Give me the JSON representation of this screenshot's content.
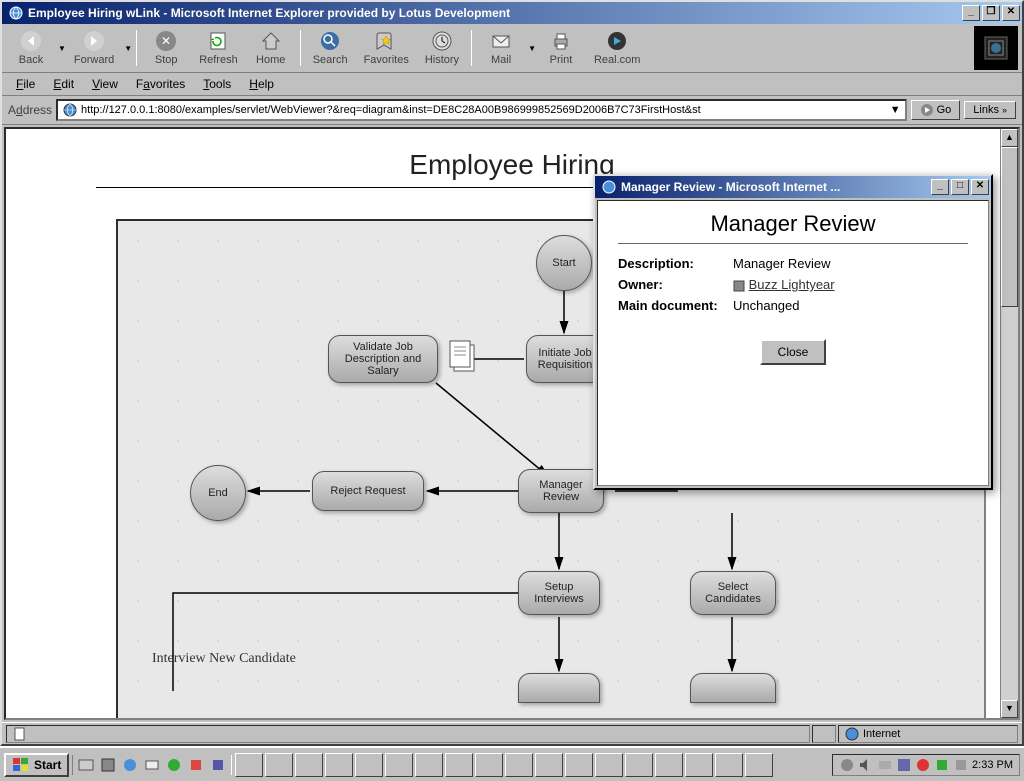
{
  "window": {
    "title": "Employee Hiring wLink - Microsoft Internet Explorer provided by Lotus Development"
  },
  "toolbar": {
    "back": "Back",
    "forward": "Forward",
    "stop": "Stop",
    "refresh": "Refresh",
    "home": "Home",
    "search": "Search",
    "favorites": "Favorites",
    "history": "History",
    "mail": "Mail",
    "print": "Print",
    "realcom": "Real.com"
  },
  "menu": {
    "file": "File",
    "edit": "Edit",
    "view": "View",
    "favorites": "Favorites",
    "tools": "Tools",
    "help": "Help"
  },
  "addressbar": {
    "label": "Address",
    "url": "http://127.0.0.1:8080/examples/servlet/WebViewer?&req=diagram&inst=DE8C28A00B986999852569D2006B7C73FirstHost&st",
    "go": "Go",
    "links": "Links"
  },
  "page": {
    "title": "Employee Hiring"
  },
  "diagram": {
    "start": "Start",
    "validate": "Validate Job Description and Salary",
    "initiate": "Initiate Job Requisition",
    "end": "End",
    "reject": "Reject Request",
    "manager": "Manager Review",
    "setup": "Setup Interviews",
    "select": "Select Candidates",
    "interview_label": "Interview New Candidate"
  },
  "popup": {
    "window_title": "Manager Review - Microsoft Internet ...",
    "title": "Manager Review",
    "rows": {
      "desc_label": "Description:",
      "desc_value": "Manager Review",
      "owner_label": "Owner:",
      "owner_value": "Buzz Lightyear",
      "maindoc_label": "Main document:",
      "maindoc_value": "Unchanged"
    },
    "close": "Close"
  },
  "status": {
    "zone": "Internet"
  },
  "taskbar": {
    "start": "Start",
    "clock": "2:33 PM"
  }
}
